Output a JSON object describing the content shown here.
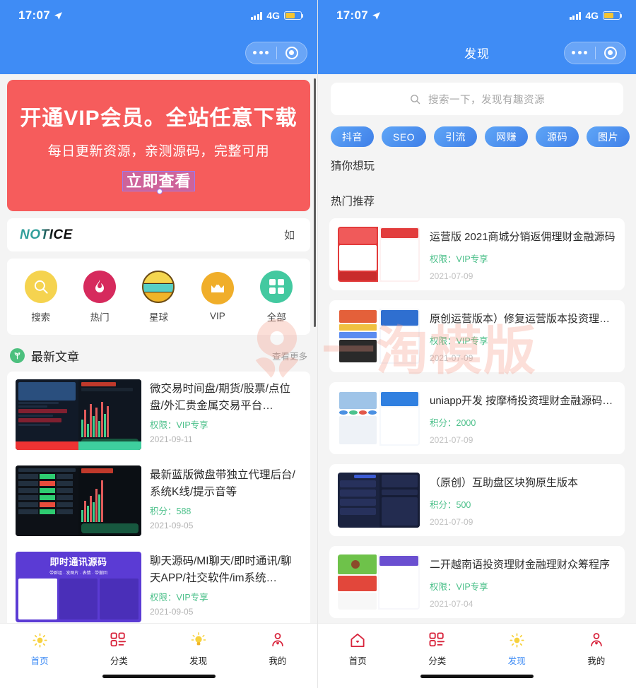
{
  "theme": {
    "brand_blue": "#3f8cf5",
    "banner_red": "#f65c5c",
    "accent_green": "#4cc08a",
    "tag_blue": "#3f7fe8"
  },
  "status_bar": {
    "time": "17:07",
    "network": "4G",
    "location_icon": "location-arrow-icon",
    "battery_icon": "battery-icon",
    "signal_icon": "signal-bars-icon"
  },
  "capsule": {
    "menu_icon": "more-dots-icon",
    "close_icon": "target-circle-icon"
  },
  "left": {
    "nav_title": "",
    "banner": {
      "headline": "开通VIP会员。全站任意下载",
      "subline": "每日更新资源，亲测源码，完整可用",
      "cta": "立即查看"
    },
    "notice": {
      "logo_text": "NOTICE",
      "marquee_text": "如"
    },
    "quick_icons": [
      {
        "label": "搜索",
        "icon": "search-icon"
      },
      {
        "label": "热门",
        "icon": "flame-icon"
      },
      {
        "label": "星球",
        "icon": "planet-icon"
      },
      {
        "label": "VIP",
        "icon": "crown-icon"
      },
      {
        "label": "全部",
        "icon": "grid-icon"
      }
    ],
    "section": {
      "title": "最新文章",
      "icon": "sprout-icon",
      "more": "查看更多"
    },
    "articles": [
      {
        "title": "微交易时间盘/期货/股票/点位盘/外汇贵金属交易平台…",
        "meta_label": "权限：",
        "meta_value": "VIP专享",
        "date": "2021-09-11",
        "thumb": "trading-dashboard-thumb"
      },
      {
        "title": "最新蓝版微盘带独立代理后台/系统K线/提示音等",
        "meta_label": "积分：",
        "meta_value": "588",
        "date": "2021-09-05",
        "thumb": "kline-chart-thumb"
      },
      {
        "title": "聊天源码/MI聊天/即时通讯/聊天APP/社交软件/im系统…",
        "meta_label": "权限：",
        "meta_value": "VIP专享",
        "date": "2021-09-05",
        "thumb": "im-chat-thumb"
      }
    ],
    "tabs": [
      {
        "label": "首页",
        "icon": "sun-icon",
        "active": true
      },
      {
        "label": "分类",
        "icon": "grid-list-icon",
        "active": false
      },
      {
        "label": "发现",
        "icon": "lightbulb-icon",
        "active": false
      },
      {
        "label": "我的",
        "icon": "user-heart-icon",
        "active": false
      }
    ]
  },
  "right": {
    "nav_title": "发现",
    "search": {
      "placeholder": "搜索一下，发现有趣资源",
      "icon": "search-icon"
    },
    "tags": [
      "抖音",
      "SEO",
      "引流",
      "网赚",
      "源码",
      "图片"
    ],
    "heading_guess": "猜你想玩",
    "heading_hot": "热门推荐",
    "cards": [
      {
        "title": "运营版 2021商城分销返佣理财金融源码",
        "meta_label": "权限：",
        "meta_value": "VIP专享",
        "date": "2021-07-09",
        "thumb": "mall-red-thumb"
      },
      {
        "title": "原创运营版本）修复运营版本投资理财金…",
        "meta_label": "权限：",
        "meta_value": "VIP专享",
        "date": "2021-07-09",
        "thumb": "finance-blue-thumb"
      },
      {
        "title": "uniapp开发 按摩椅投资理财金融源码系…",
        "meta_label": "积分：",
        "meta_value": "2000",
        "date": "2021-07-09",
        "thumb": "uniapp-thumb"
      },
      {
        "title": "（原创）互助盘区块狗原生版本",
        "meta_label": "积分：",
        "meta_value": "500",
        "date": "2021-07-09",
        "thumb": "blockchain-dark-thumb"
      },
      {
        "title": "二开越南语投资理财金融理财众筹程序",
        "meta_label": "权限：",
        "meta_value": "VIP专享",
        "date": "2021-07-04",
        "thumb": "vietnam-game-thumb"
      }
    ],
    "tabs": [
      {
        "label": "首页",
        "icon": "home-heart-icon",
        "active": false
      },
      {
        "label": "分类",
        "icon": "grid-list-icon",
        "active": false
      },
      {
        "label": "发现",
        "icon": "sun-icon",
        "active": true
      },
      {
        "label": "我的",
        "icon": "user-heart-icon",
        "active": false
      }
    ]
  },
  "watermark": {
    "text": "一淘模版",
    "logo_icon": "flower-logo-icon"
  }
}
